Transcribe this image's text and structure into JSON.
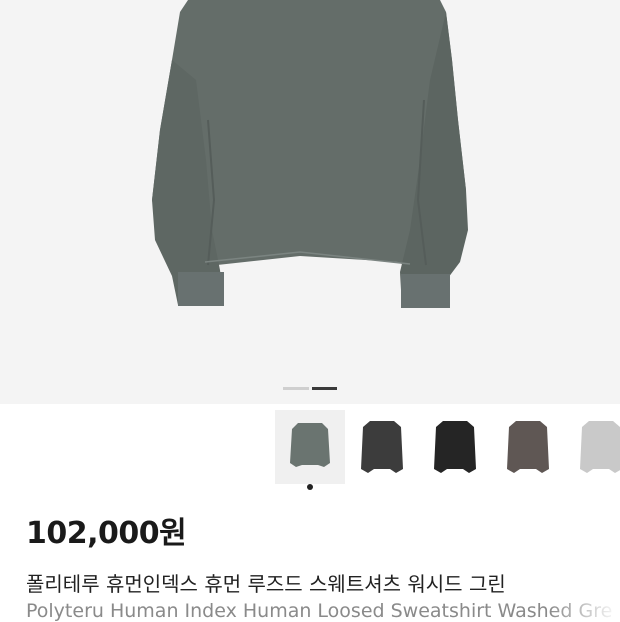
{
  "product": {
    "price": "102,000원",
    "name_kr": "폴리테루 휴먼인덱스 휴먼 루즈드 스웨트셔츠 워시드 그린",
    "name_en": "Polyteru Human Index Human Loosed Sweatshirt Washed Gre"
  },
  "gallery": {
    "current_slide": 2,
    "total_slides": 2,
    "main_image": "sweatshirt-washed-green",
    "main_color": "#646d69"
  },
  "color_options": [
    {
      "name": "washed-green",
      "color": "#6a7470",
      "selected": true
    },
    {
      "name": "charcoal",
      "color": "#3c3c3c",
      "selected": false
    },
    {
      "name": "black",
      "color": "#252525",
      "selected": false
    },
    {
      "name": "brown-gray",
      "color": "#5f5754",
      "selected": false
    },
    {
      "name": "light-gray",
      "color": "#c9c9c9",
      "selected": false
    }
  ]
}
